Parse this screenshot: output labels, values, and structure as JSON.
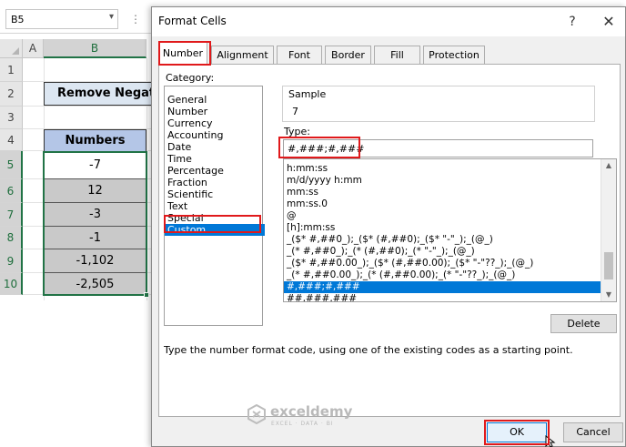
{
  "excel": {
    "name_box": "B5",
    "columns": [
      "A",
      "B"
    ],
    "rows": [
      "1",
      "2",
      "3",
      "4",
      "5",
      "6",
      "7",
      "8",
      "9",
      "10"
    ],
    "title_text": "Remove Negative Sign",
    "numbers_header": "Numbers",
    "numbers": [
      "-7",
      "12",
      "-3",
      "-1",
      "-1,102",
      "-2,505"
    ]
  },
  "dialog": {
    "title": "Format Cells",
    "help": "?",
    "close": "✕",
    "tabs": [
      {
        "label": "Number",
        "active": true
      },
      {
        "label": "Alignment",
        "active": false
      },
      {
        "label": "Font",
        "active": false
      },
      {
        "label": "Border",
        "active": false
      },
      {
        "label": "Fill",
        "active": false
      },
      {
        "label": "Protection",
        "active": false
      }
    ],
    "category_label": "Category:",
    "categories": [
      "General",
      "Number",
      "Currency",
      "Accounting",
      "Date",
      "Time",
      "Percentage",
      "Fraction",
      "Scientific",
      "Text",
      "Special",
      "Custom"
    ],
    "selected_category": "Custom",
    "sample_label": "Sample",
    "sample_value": "7",
    "type_label": "Type:",
    "type_value": "#,###;#,###",
    "format_codes": [
      "h:mm:ss",
      "m/d/yyyy h:mm",
      "mm:ss",
      "mm:ss.0",
      "@",
      "[h]:mm:ss",
      "_($* #,##0_);_($* (#,##0);_($* \"-\"_);_(@_)",
      "_(* #,##0_);_(* (#,##0);_(* \"-\"_);_(@_)",
      "_($* #,##0.00_);_($* (#,##0.00);_($* \"-\"??_);_(@_)",
      "_(* #,##0.00_);_(* (#,##0.00);_(* \"-\"??_);_(@_)",
      "#,###;#,###",
      "##,###,###"
    ],
    "selected_format": "#,###;#,###",
    "delete_label": "Delete",
    "help_text": "Type the number format code, using one of the existing codes as a starting point.",
    "ok_label": "OK",
    "cancel_label": "Cancel"
  },
  "watermark": {
    "name": "exceldemy",
    "tagline": "EXCEL · DATA · BI"
  },
  "colors": {
    "accent_selection": "#0078d7",
    "highlight_box": "#e0191b",
    "excel_green": "#217346",
    "numbers_header_fill": "#b4c6e7",
    "title_fill": "#dce6f1",
    "dark_cell_fill": "#c9c9c9"
  }
}
